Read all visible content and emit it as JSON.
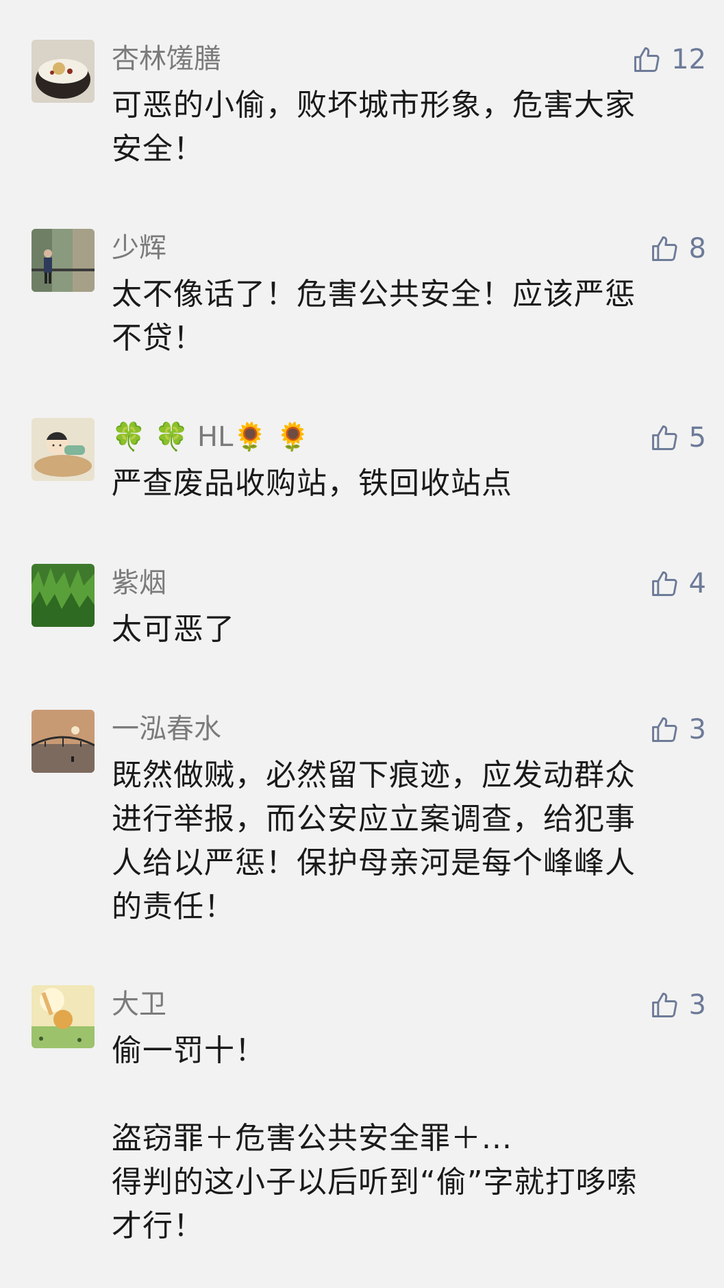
{
  "comments": [
    {
      "name": "杏林馐膳",
      "likes": "12",
      "text": "可恶的小偷，败坏城市形象，危害大家\n安全！"
    },
    {
      "name": "少辉",
      "likes": "8",
      "text": "太不像话了！危害公共安全！应该严惩\n不贷！"
    },
    {
      "name": "🍀 🍀 HL🌻 🌻",
      "likes": "5",
      "text": "严查废品收购站，铁回收站点"
    },
    {
      "name": "紫烟",
      "likes": "4",
      "text": "太可恶了"
    },
    {
      "name": "一泓春水",
      "likes": "3",
      "text": "既然做贼，必然留下痕迹，应发动群众\n进行举报，而公安应立案调查，给犯事\n人给以严惩！保护母亲河是每个峰峰人\n的责任！"
    },
    {
      "name": "大卫",
      "likes": "3",
      "text": "偷一罚十！\n\n盗窃罪＋危害公共安全罪＋...\n得判的这小子以后听到“偷”字就打哆嗦\n才行！"
    }
  ],
  "icons": {
    "like": "thumbs-up-outline-icon"
  },
  "colors": {
    "background": "#f2f2f2",
    "name": "#7b7b7b",
    "like": "#6d7b98",
    "text": "#1a1a1a"
  }
}
